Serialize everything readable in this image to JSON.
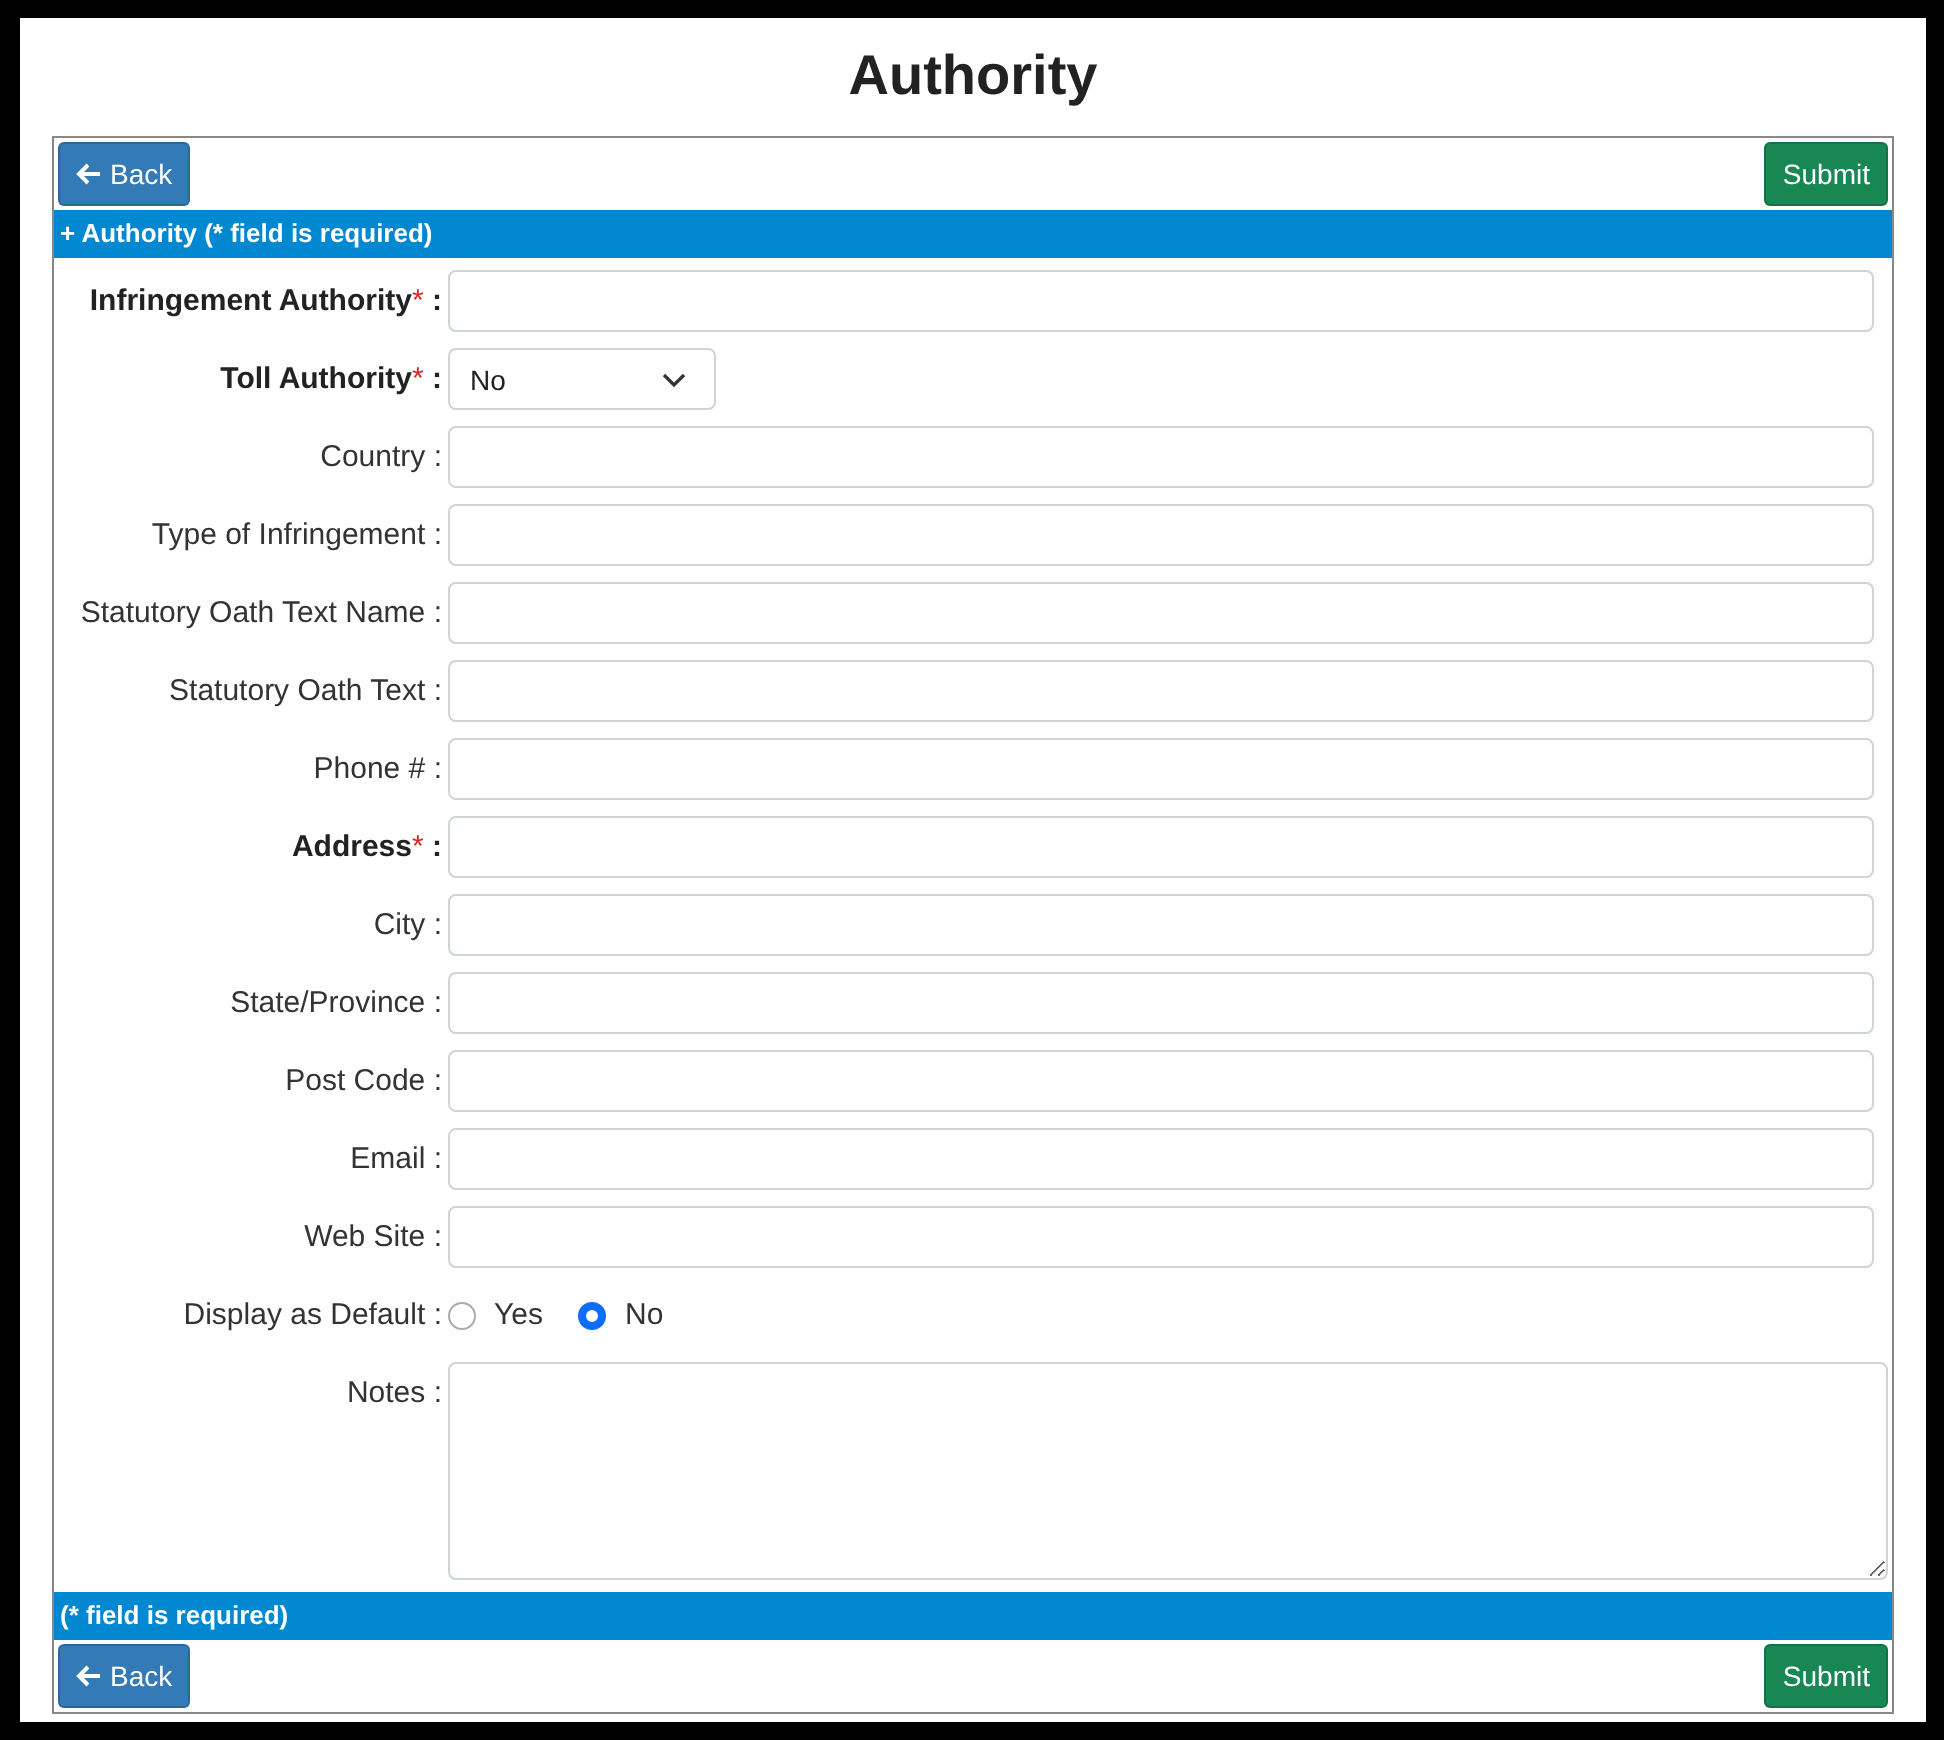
{
  "title": "Authority",
  "top_buttons": {
    "back": "Back",
    "submit": "Submit"
  },
  "header_bar": {
    "icon": "+",
    "text": "Authority (* field is required)"
  },
  "fields": [
    {
      "kind": "text",
      "label": "Infringement Authority",
      "required_mark": "*",
      "colon": ":"
    },
    {
      "kind": "select",
      "label": "Toll Authority",
      "required_mark": "*",
      "colon": ":",
      "value": "No"
    },
    {
      "kind": "text",
      "label": "Country",
      "colon": ":"
    },
    {
      "kind": "text",
      "label": "Type of Infringement",
      "colon": ":"
    },
    {
      "kind": "text",
      "label": "Statutory Oath Text Name",
      "colon": ":"
    },
    {
      "kind": "text",
      "label": "Statutory Oath Text",
      "colon": ":"
    },
    {
      "kind": "text",
      "label": "Phone #",
      "colon": ":"
    },
    {
      "kind": "text",
      "label": "Address",
      "required_mark": "*",
      "colon": ":"
    },
    {
      "kind": "text",
      "label": "City",
      "colon": ":"
    },
    {
      "kind": "text",
      "label": "State/Province",
      "colon": ":"
    },
    {
      "kind": "text",
      "label": "Post Code",
      "colon": ":"
    },
    {
      "kind": "text",
      "label": "Email",
      "colon": ":"
    },
    {
      "kind": "text",
      "label": "Web Site",
      "colon": ":"
    },
    {
      "kind": "radio",
      "label": "Display as Default",
      "colon": ":",
      "options": [
        {
          "label": "Yes",
          "selected": false
        },
        {
          "label": "No",
          "selected": true
        }
      ]
    },
    {
      "kind": "textarea",
      "label": "Notes",
      "colon": ":"
    }
  ],
  "footer_bar": {
    "text": "(* field is required)"
  },
  "bottom_buttons": {
    "back": "Back",
    "submit": "Submit"
  }
}
